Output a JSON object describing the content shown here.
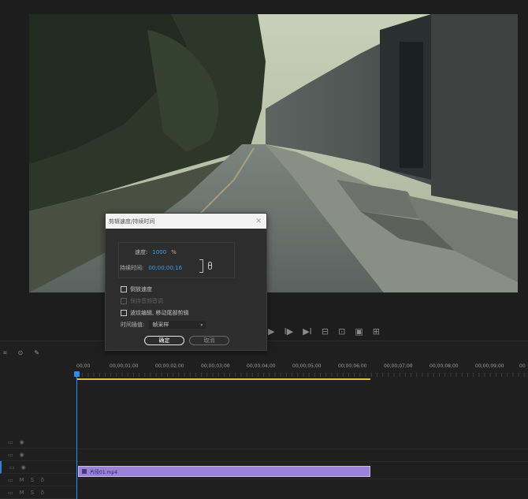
{
  "dialog": {
    "title": "剪辑速度/持续时间",
    "close_icon": "close-icon",
    "speed_label": "速度:",
    "speed_value": "1000",
    "speed_unit": "%",
    "duration_label": "持续时间:",
    "duration_value": "00;00;00;16",
    "link_icon": "chain-link-icon",
    "reverse_label": "倒放速度",
    "maintain_pitch_label": "保持音频音调",
    "ripple_label": "波纹编辑, 移动尾部剪辑",
    "interpolation_label": "时间插值:",
    "interpolation_value": "帧采样",
    "ok_label": "确定",
    "cancel_label": "取消"
  },
  "transport": {
    "buttons": [
      "▶",
      "I▶",
      "▶I",
      "⊟",
      "⊡",
      "▣",
      "⊞"
    ]
  },
  "timeline": {
    "tools": [
      "⌗",
      "⊙",
      "✎"
    ],
    "ruler": [
      "00;00",
      "00;00;01;00",
      "00;00;02;00",
      "00;00;03;00",
      "00;00;04;00",
      "00;00;05;00",
      "00;00;06;00",
      "00;00;07;00",
      "00;00;08;00",
      "00;00;09;00",
      "00"
    ],
    "clip_name": "片段01.mp4"
  },
  "colors": {
    "playhead": "#2d8ceb",
    "work_area": "#d9c733",
    "clip": "#9a82d8",
    "value_blue": "#3aa0e8"
  }
}
